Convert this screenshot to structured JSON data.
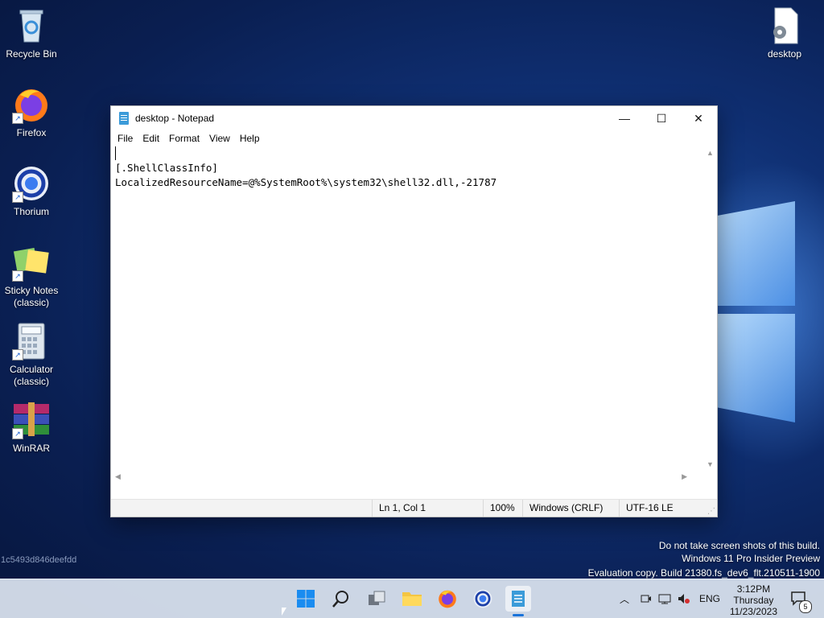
{
  "desktop": {
    "icons": [
      {
        "label": "Recycle Bin"
      },
      {
        "label": "Firefox"
      },
      {
        "label": "Thorium"
      },
      {
        "label": "Sticky Notes (classic)"
      },
      {
        "label": "Calculator (classic)"
      },
      {
        "label": "WinRAR"
      },
      {
        "label": "desktop"
      }
    ],
    "hash": "1c5493d846deefdd",
    "watermark": {
      "line1": "Do not take screen shots of this build.",
      "line2": "Windows 11 Pro Insider Preview",
      "line3": "Evaluation copy. Build 21380.fs_dev6_flt.210511-1900"
    }
  },
  "notepad": {
    "title": "desktop - Notepad",
    "controls": {
      "minimize": "—",
      "maximize": "☐",
      "close": "✕"
    },
    "menu": [
      "File",
      "Edit",
      "Format",
      "View",
      "Help"
    ],
    "content": {
      "line1": "[.ShellClassInfo]",
      "line2": "LocalizedResourceName=@%SystemRoot%\\system32\\shell32.dll,-21787"
    },
    "status": {
      "position": "Ln 1, Col 1",
      "zoom": "100%",
      "line_ending": "Windows (CRLF)",
      "encoding": "UTF-16 LE"
    }
  },
  "taskbar": {
    "tray": {
      "language": "ENG",
      "time": "3:12PM",
      "day": "Thursday",
      "date": "11/23/2023",
      "notification_count": "5"
    }
  }
}
